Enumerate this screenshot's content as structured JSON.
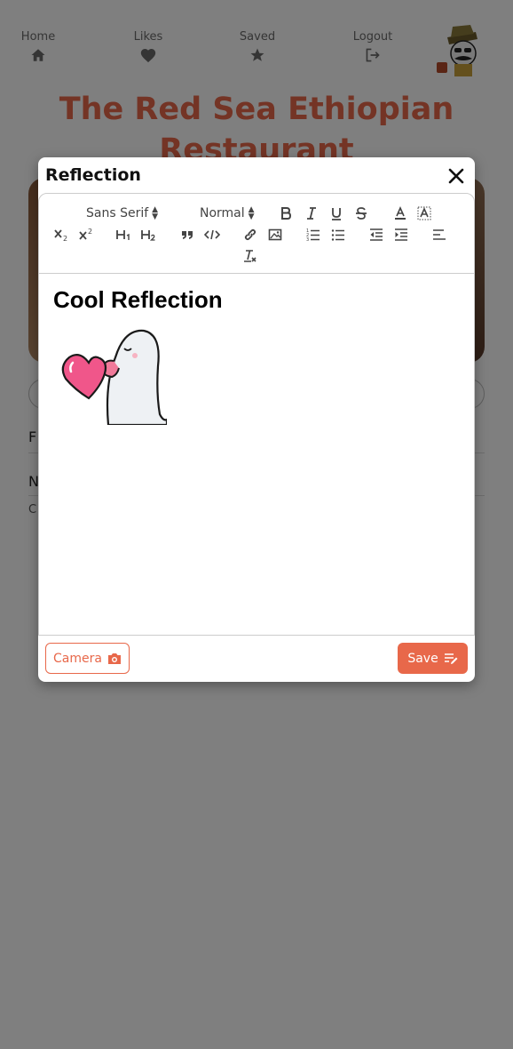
{
  "nav": {
    "home": "Home",
    "likes": "Likes",
    "saved": "Saved",
    "logout": "Logout"
  },
  "restaurant": {
    "title": "The Red Sea Ethiopian Restaurant"
  },
  "background_rows": {
    "row1": "F",
    "row2": "N",
    "row3": "C"
  },
  "modal": {
    "title": "Reflection",
    "font_picker": "Sans Serif",
    "size_picker": "Normal",
    "content_heading": "Cool Reflection",
    "camera_label": "Camera",
    "save_label": "Save"
  },
  "colors": {
    "accent": "#e8684a",
    "overlay": "rgba(0,0,0,0.5)"
  }
}
